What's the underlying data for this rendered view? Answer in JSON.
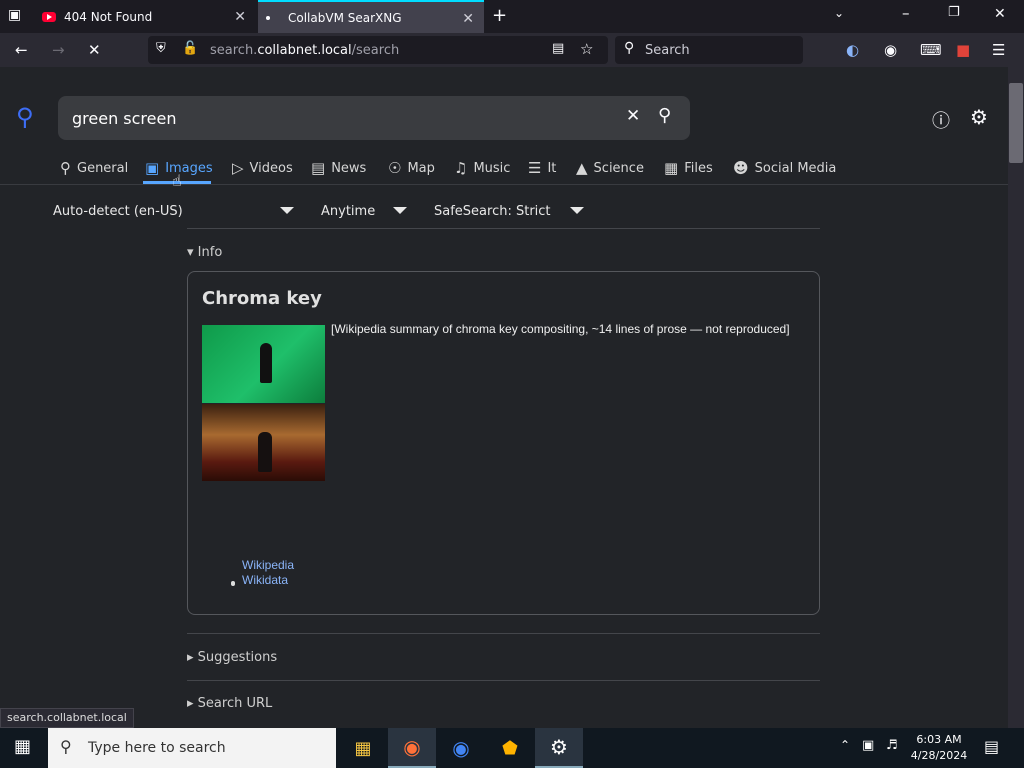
{
  "browser": {
    "tabs": [
      {
        "label": "404 Not Found",
        "icon": "youtube-icon"
      },
      {
        "label": "CollabVM SearXNG",
        "icon": "dot-icon",
        "active": true
      }
    ],
    "url_host_prefix": "search.",
    "url_host_main": "collabnet.local",
    "url_path": "/search",
    "search_placeholder": "Search"
  },
  "search": {
    "query": "green screen",
    "categories": [
      {
        "label": "General",
        "icon": "search-icon"
      },
      {
        "label": "Images",
        "icon": "image-icon",
        "active": true
      },
      {
        "label": "Videos",
        "icon": "play-icon"
      },
      {
        "label": "News",
        "icon": "newspaper-icon"
      },
      {
        "label": "Map",
        "icon": "map-pin-icon"
      },
      {
        "label": "Music",
        "icon": "music-icon"
      },
      {
        "label": "It",
        "icon": "layers-icon"
      },
      {
        "label": "Science",
        "icon": "graduation-cap-icon"
      },
      {
        "label": "Files",
        "icon": "files-icon"
      },
      {
        "label": "Social Media",
        "icon": "people-icon"
      }
    ],
    "filters": {
      "language": "Auto-detect (en-US)",
      "time": "Anytime",
      "safesearch": "SafeSearch: Strict"
    }
  },
  "infobox": {
    "section_label": "Info",
    "title": "Chroma key",
    "summary": "[Wikipedia summary of chroma key compositing, ~14 lines of prose — not reproduced]",
    "links": [
      "Wikipedia",
      "Wikidata"
    ]
  },
  "sections": {
    "suggestions": "Suggestions",
    "search_url": "Search URL"
  },
  "status": {
    "hover_url": "search.collabnet.local"
  },
  "taskbar": {
    "search_placeholder": "Type here to search",
    "time": "6:03 AM",
    "date": "4/28/2024"
  },
  "colors": {
    "accent": "#58a6ff",
    "tab_highlight": "#00ddff",
    "page_bg": "#222428"
  }
}
